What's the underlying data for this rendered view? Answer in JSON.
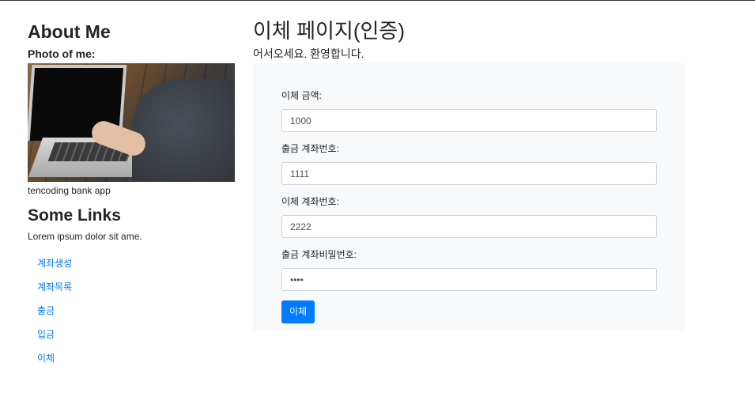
{
  "sidebar": {
    "heading": "About Me",
    "photo_label": "Photo of me:",
    "caption": "tencoding bank app",
    "links_heading": "Some Links",
    "lorem": "Lorem ipsum dolor sit ame.",
    "nav": [
      "계좌생성",
      "계좌목록",
      "출금",
      "입금",
      "이체"
    ]
  },
  "main": {
    "title": "이체 페이지(인증)",
    "welcome": "어서오세요. 환영합니다.",
    "form": {
      "amount_label": "이체 금액:",
      "amount_value": "1000",
      "withdraw_account_label": "출금 계좌번호:",
      "withdraw_account_value": "1111",
      "deposit_account_label": "이체 계좌번호:",
      "deposit_account_value": "2222",
      "password_label": "출금 계좌비밀번호:",
      "password_value": "••••",
      "submit_label": "이체"
    }
  },
  "colors": {
    "link": "#007bff",
    "button": "#007bff",
    "card_bg": "#f8f9fa"
  }
}
